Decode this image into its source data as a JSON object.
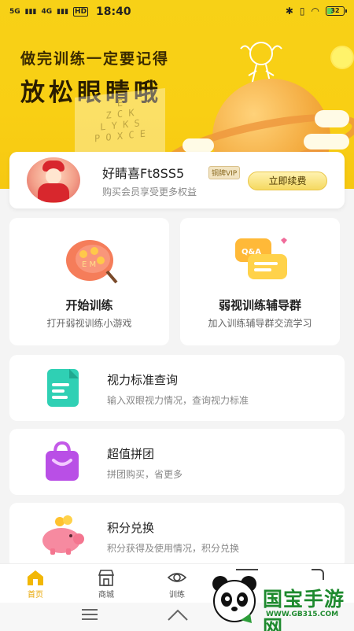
{
  "status": {
    "sig1": "5G",
    "sig2": "4G",
    "hd": "HD",
    "time": "18:40",
    "battery": "32",
    "battery_level": 0.32
  },
  "hero": {
    "subtitle": "做完训练一定要记得",
    "title": "放松眼睛哦"
  },
  "member": {
    "username": "好睛喜Ft8SS5",
    "badge": "铜牌VIP",
    "desc": "购买会员享受更多权益",
    "renew_label": "立即续费"
  },
  "features": [
    {
      "title": "开始训练",
      "desc": "打开弱视训练小游戏",
      "icon": "palette-icon"
    },
    {
      "title": "弱视训练辅导群",
      "desc": "加入训练辅导群交流学习",
      "icon": "chat-bubbles-icon"
    }
  ],
  "list": [
    {
      "title": "视力标准查询",
      "desc": "输入双眼视力情况，查询视力标准",
      "icon": "document-icon"
    },
    {
      "title": "超值拼团",
      "desc": "拼团购买，省更多",
      "icon": "shopping-bag-icon"
    },
    {
      "title": "积分兑换",
      "desc": "积分获得及使用情况，积分兑换",
      "icon": "piggy-bank-icon"
    }
  ],
  "tabs": [
    {
      "label": "首页",
      "icon": "home-icon",
      "active": true
    },
    {
      "label": "商城",
      "icon": "store-icon",
      "active": false
    },
    {
      "label": "训练",
      "icon": "eye-icon",
      "active": false
    }
  ],
  "watermark": {
    "text": "国宝手游网",
    "url": "WWW.GB315.COM"
  },
  "colors": {
    "accent": "#f7d117",
    "tab_active": "#e8a600"
  }
}
